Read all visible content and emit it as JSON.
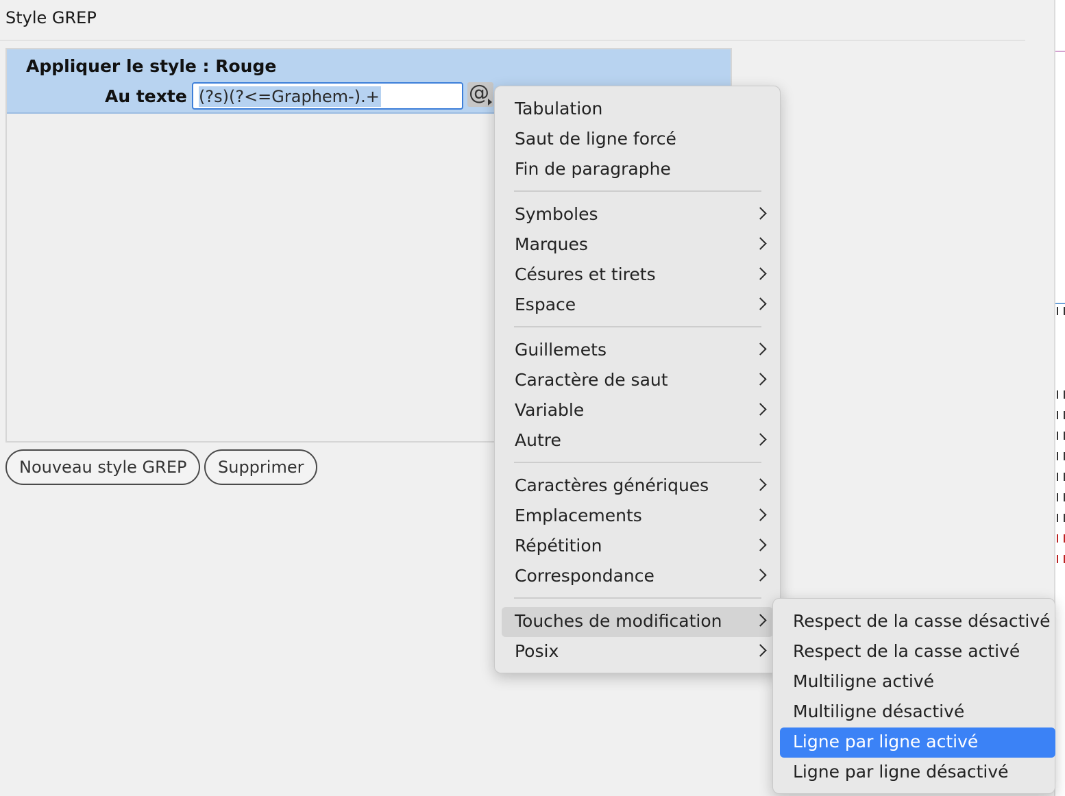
{
  "panel": {
    "title": "Style GREP"
  },
  "rule": {
    "style_line": "Appliquer le style : Rouge",
    "text_label": "Au texte :",
    "grep_value": "(?s)(?<=Graphem-).+",
    "special_char_button": "@"
  },
  "buttons": {
    "new_label": "Nouveau style GREP",
    "delete_label": "Supprimer"
  },
  "menu": {
    "items": [
      {
        "label": "Tabulation",
        "submenu": false
      },
      {
        "label": "Saut de ligne forcé",
        "submenu": false
      },
      {
        "label": "Fin de paragraphe",
        "submenu": false
      },
      {
        "label": "Symboles",
        "submenu": true
      },
      {
        "label": "Marques",
        "submenu": true
      },
      {
        "label": "Césures et tirets",
        "submenu": true
      },
      {
        "label": "Espace",
        "submenu": true
      },
      {
        "label": "Guillemets",
        "submenu": true
      },
      {
        "label": "Caractère de saut",
        "submenu": true
      },
      {
        "label": "Variable",
        "submenu": true
      },
      {
        "label": "Autre",
        "submenu": true
      },
      {
        "label": "Caractères génériques",
        "submenu": true
      },
      {
        "label": "Emplacements",
        "submenu": true
      },
      {
        "label": "Répétition",
        "submenu": true
      },
      {
        "label": "Correspondance",
        "submenu": true
      },
      {
        "label": "Touches de modification",
        "submenu": true,
        "state": "hovered"
      },
      {
        "label": "Posix",
        "submenu": true
      }
    ]
  },
  "submenu": {
    "items": [
      {
        "label": "Respect de la casse désactivé"
      },
      {
        "label": "Respect de la casse activé"
      },
      {
        "label": "Multiligne activé"
      },
      {
        "label": "Multiligne désactivé"
      },
      {
        "label": "Ligne par ligne activé",
        "state": "selected"
      },
      {
        "label": "Ligne par ligne désactivé"
      }
    ]
  },
  "colors": {
    "selection_accent": "#3b82f6",
    "rule_highlight": "#b8d3f0",
    "input_focus": "#3d7fd9"
  },
  "icons": {
    "chevron": "chevron-right-icon",
    "special_characters": "at-sign-icon"
  }
}
